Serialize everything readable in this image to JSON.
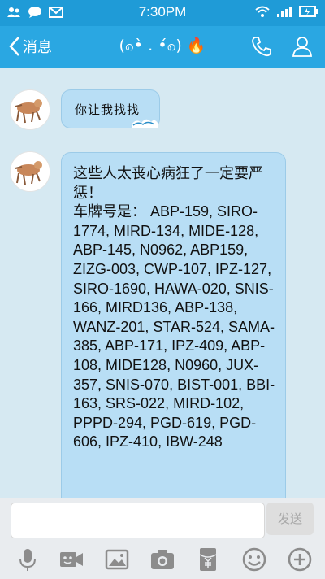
{
  "status_bar": {
    "time": "7:30PM"
  },
  "header": {
    "back_label": "消息",
    "title": "(၈•̀ ․ •́၈) 🔥"
  },
  "messages": [
    {
      "text": "你让我找找"
    },
    {
      "text": "这些人太丧心病狂了一定要严惩！\n车牌号是： ABP-159, SIRO-1774, MIRD-134, MIDE-128, ABP-145, N0962, ABP159, ZIZG-003, CWP-107, IPZ-127, SIRO-1690, HAWA-020, SNIS-166, MIRD136, ABP-138, WANZ-201, STAR-524, SAMA-385, ABP-171, IPZ-409, ABP-108, MIDE128, N0960, JUX-357, SNIS-070, BIST-001, BBI-163, SRS-022, MIRD-102, PPPD-294, PGD-619, PGD-606, IPZ-410, IBW-248"
    }
  ],
  "composer": {
    "input_value": "",
    "send_label": "发送"
  },
  "icons": {
    "back": "chevron-left-icon",
    "phone": "phone-icon",
    "contact": "person-icon",
    "mic": "microphone-icon",
    "video": "video-icon",
    "image": "image-icon",
    "camera": "camera-icon",
    "wallet": "red-packet-icon",
    "emoji": "smiley-icon",
    "more": "plus-icon"
  },
  "colors": {
    "status_bar": "#1f9bd7",
    "title_bar": "#2aa7e2",
    "chat_bg": "#d6e9f2",
    "bubble": "#b8def5"
  }
}
